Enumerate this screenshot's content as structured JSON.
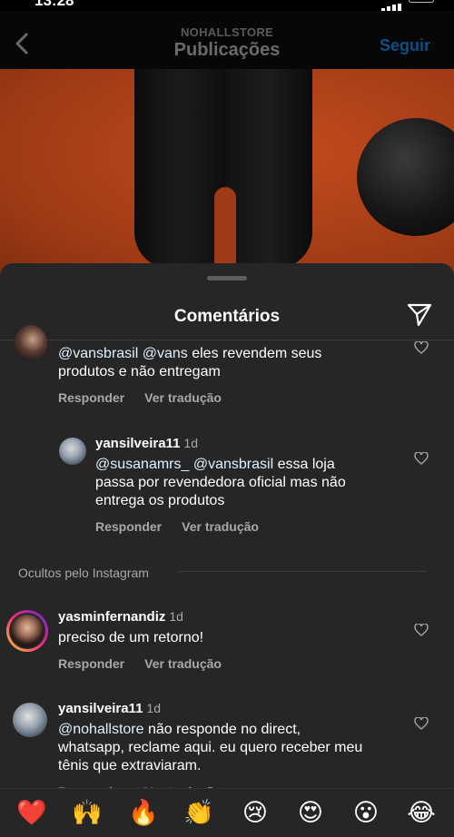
{
  "status": {
    "time": "13:28"
  },
  "header": {
    "username": "NOHALLSTORE",
    "title": "Publicações",
    "follow_label": "Seguir"
  },
  "sheet": {
    "title": "Comentários"
  },
  "comments": [
    {
      "text_mentions": [
        "@vansbrasil",
        "@vans"
      ],
      "text_line1_rest": " eles revendem seus",
      "text_line2": "produtos e não entregam",
      "reply": "Responder",
      "translate": "Ver tradução"
    },
    {
      "username": "yansilveira11",
      "time": "1d",
      "mention1": "@susanamrs_",
      "mention2": "@vansbrasil",
      "line1_rest": " essa loja",
      "line2": "passa por revendedora oficial mas não",
      "line3": "entrega os produtos",
      "reply": "Responder",
      "translate": "Ver tradução"
    }
  ],
  "hidden_section": {
    "label": "Ocultos pelo Instagram"
  },
  "hidden_comments": [
    {
      "username": "yasminfernandiz",
      "time": "1d",
      "text": "preciso de um retorno!",
      "reply": "Responder",
      "translate": "Ver tradução"
    },
    {
      "username": "yansilveira11",
      "time": "1d",
      "mention": "@nohallstore",
      "line1_rest": " não responde no direct,",
      "line2": "whatsapp, reclame aqui. eu quero receber meu",
      "line3": "tênis que extraviaram.",
      "reply": "Responder",
      "translate": "Ver tradução"
    }
  ],
  "emoji_bar": [
    "❤️",
    "🙌",
    "🔥",
    "👏",
    "😢",
    "😍",
    "😮",
    "😂"
  ]
}
